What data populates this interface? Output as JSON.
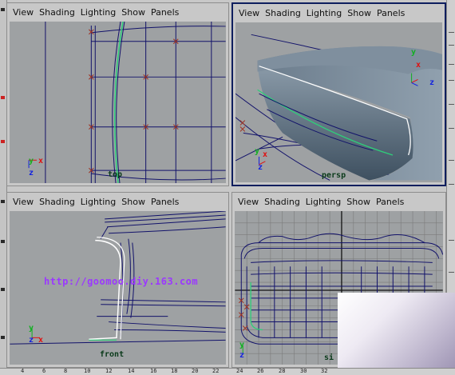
{
  "panels": {
    "top": {
      "menu": [
        "View",
        "Shading",
        "Lighting",
        "Show",
        "Panels"
      ],
      "camera": "top",
      "axis_h": "x",
      "axis_v": "y",
      "axis_c": "z"
    },
    "persp": {
      "menu": [
        "View",
        "Shading",
        "Lighting",
        "Show",
        "Panels"
      ],
      "camera": "persp",
      "axis_h": "x",
      "axis_v": "y",
      "axis_c": "z"
    },
    "front": {
      "menu": [
        "View",
        "Shading",
        "Lighting",
        "Show",
        "Panels"
      ],
      "camera": "front",
      "axis_h": "x",
      "axis_v": "y",
      "axis_c": "z"
    },
    "side": {
      "menu": [
        "View",
        "Shading",
        "Lighting",
        "Show",
        "Panels"
      ],
      "camera": "si",
      "axis_h": "z",
      "axis_v": "y",
      "axis_c": "z"
    }
  },
  "watermark": "http://goomoo.diy.163.com",
  "ruler_labels": [
    "4",
    "6",
    "8",
    "10",
    "12",
    "14",
    "16",
    "18",
    "20",
    "22",
    "24",
    "26",
    "28",
    "30",
    "32"
  ],
  "colors": {
    "background": "#c8c8c8",
    "viewport": "#9ea1a3",
    "wire": "#12126a",
    "active_border": "#0e1e5e",
    "curve_green": "#2ecf7a",
    "axis_x": "#e01010",
    "axis_y": "#10b020",
    "axis_z": "#1020e0"
  }
}
